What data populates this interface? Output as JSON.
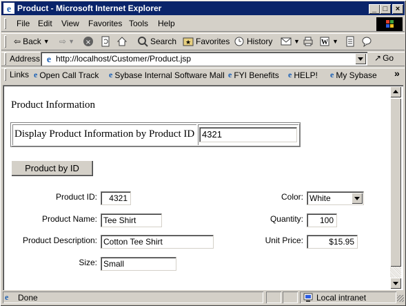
{
  "window": {
    "title": "Product - Microsoft Internet Explorer",
    "min_label": "_",
    "max_label": "□",
    "close_label": "×"
  },
  "menu": [
    "File",
    "Edit",
    "View",
    "Favorites",
    "Tools",
    "Help"
  ],
  "toolbar": {
    "back": "Back",
    "search": "Search",
    "favorites": "Favorites",
    "history": "History"
  },
  "address": {
    "label": "Address",
    "url": "http://localhost/Customer/Product.jsp",
    "go": "Go"
  },
  "links": {
    "label": "Links",
    "items": [
      "Open Call Track",
      "Sybase Internal Software Mall",
      "FYI Benefits",
      "HELP!",
      "My Sybase"
    ],
    "more": "»"
  },
  "page": {
    "heading": "Product Information",
    "lookup_label": "Display Product Information by Product ID",
    "lookup_value": "4321",
    "lookup_button": "Product by ID",
    "fields": {
      "product_id_label": "Product ID:",
      "product_id": "4321",
      "product_name_label": "Product Name:",
      "product_name": "Tee Shirt",
      "product_desc_label": "Product Description:",
      "product_desc": "Cotton Tee Shirt",
      "size_label": "Size:",
      "size": "Small",
      "color_label": "Color:",
      "color": "White",
      "quantity_label": "Quantity:",
      "quantity": "100",
      "unit_price_label": "Unit Price:",
      "unit_price": "$15.95"
    }
  },
  "status": {
    "text": "Done",
    "zone": "Local intranet"
  },
  "colors": {
    "titlebar": "#0a246a",
    "chrome": "#d4d0c8"
  }
}
